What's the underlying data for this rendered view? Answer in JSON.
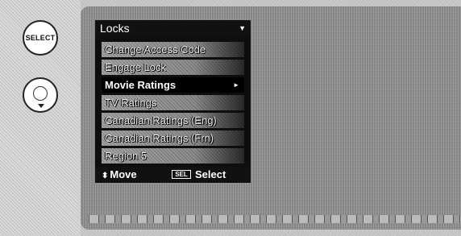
{
  "remote": {
    "select_button_label": "SELECT",
    "nav_button_icon": "navigation-pad-icon"
  },
  "menu": {
    "title": "Locks",
    "header_arrow": "▼",
    "items": [
      {
        "label": "Change Access Code",
        "selected": false
      },
      {
        "label": "Engage Lock",
        "selected": false
      },
      {
        "label": "Movie Ratings",
        "selected": true
      },
      {
        "label": "TV Ratings",
        "selected": false
      },
      {
        "label": "Canadian Ratings (Eng)",
        "selected": false
      },
      {
        "label": "Canadian Ratings (Frn)",
        "selected": false
      },
      {
        "label": "Region 5",
        "selected": false
      }
    ],
    "submenu_arrow": "►"
  },
  "footer": {
    "move_icon": "⬍",
    "move_label": "Move",
    "sel_badge": "SEL",
    "select_label": "Select"
  },
  "colors": {
    "highlight": "#000000",
    "menu_background": "#0e0e0e"
  }
}
